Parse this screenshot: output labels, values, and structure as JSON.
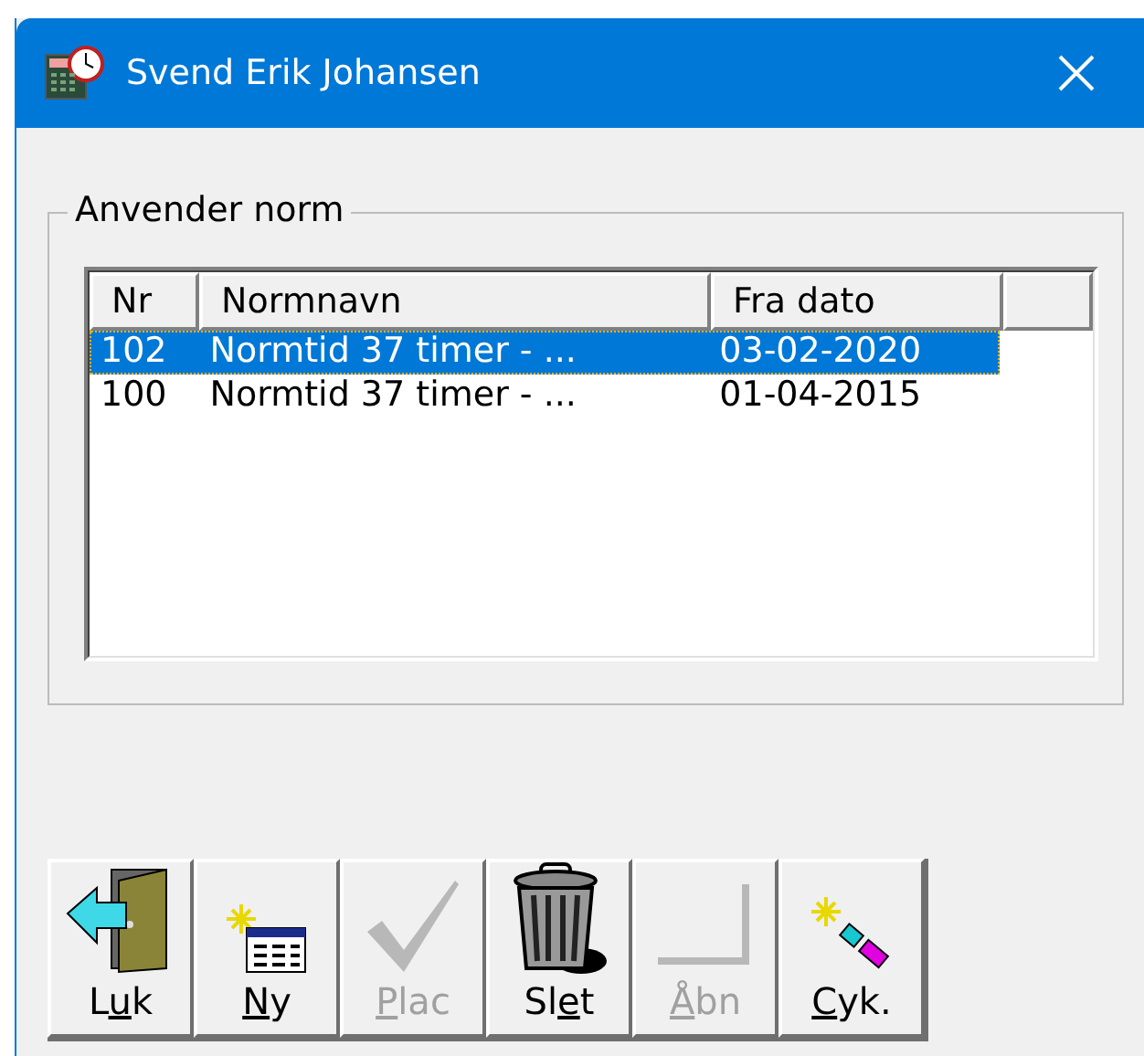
{
  "window": {
    "title": "Svend Erik Johansen"
  },
  "group": {
    "label": "Anvender norm"
  },
  "table": {
    "columns": [
      "Nr",
      "Normnavn",
      "Fra dato"
    ],
    "rows": [
      {
        "cells": [
          "102",
          "Normtid 37 timer - ...",
          "03-02-2020"
        ],
        "selected": true
      },
      {
        "cells": [
          "100",
          "Normtid 37 timer - ...",
          "01-04-2015"
        ],
        "selected": false
      }
    ]
  },
  "buttons": [
    {
      "kind": "door",
      "before": "L",
      "key": "u",
      "after": "k",
      "disabled": false
    },
    {
      "kind": "new",
      "key": "N",
      "after": "y",
      "disabled": false
    },
    {
      "kind": "check",
      "key": "P",
      "after": "lac",
      "disabled": true
    },
    {
      "kind": "trash",
      "before": "Sl",
      "key": "e",
      "after": "t",
      "disabled": false
    },
    {
      "kind": "open",
      "key": "Å",
      "after": "bn",
      "disabled": true
    },
    {
      "kind": "wand",
      "key": "C",
      "after": "yk.",
      "disabled": false
    }
  ]
}
